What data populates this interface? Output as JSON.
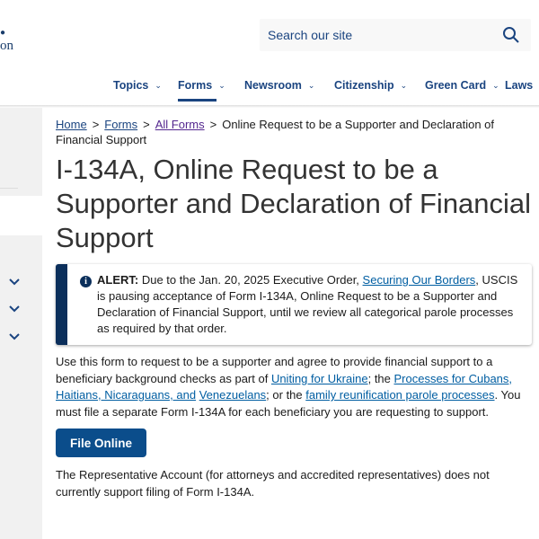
{
  "header": {
    "logo_fragment": "on",
    "search_placeholder": "Search our site",
    "nav": [
      {
        "label": "Topics",
        "active": false
      },
      {
        "label": "Forms",
        "active": true
      },
      {
        "label": "Newsroom",
        "active": false
      },
      {
        "label": "Citizenship",
        "active": false
      },
      {
        "label": "Green Card",
        "active": false
      },
      {
        "label": "Laws",
        "active": false
      }
    ]
  },
  "breadcrumb": {
    "items": [
      "Home",
      "Forms",
      "All Forms"
    ],
    "current": "Online Request to be a Supporter and Declaration of Financial Support"
  },
  "title": {
    "line1": "I-134A, Online Request to be a Supporter and",
    "line2": "Declaration of Financial Support"
  },
  "alert": {
    "label": "ALERT:",
    "t1": " Due to the Jan. 20, 2025 Executive Order, ",
    "link": "Securing Our Borders",
    "t2": ", USCIS is pausing acceptance",
    "line2": "of Form I-134A, Online Request to be a Supporter and Declaration of Financial Support, until we",
    "line3": "review all categorical parole processes as required by that order."
  },
  "intro": {
    "l1": "Use this form to request to be a supporter and agree to provide financial support to a beneficiary",
    "l2a": "background checks as part of ",
    "link1": "Uniting for Ukraine",
    "l2b": "; the ",
    "link2": "Processes for Cubans, Haitians, Nicaraguans, and",
    "link3": "Venezuelans",
    "l3a": "; or the ",
    "link4": "family reunification parole processes",
    "l3b": ". You must file a separate Form I-134A for each",
    "l4": "beneficiary you are requesting to support."
  },
  "file_online_label": "File Online",
  "representative_note": {
    "l1": "The Representative Account (for attorneys and accredited representatives) does not currently support",
    "l2": "filing of Form I-134A."
  },
  "colors": {
    "primary": "#1a4480",
    "alert_bar": "#0b2f5b",
    "button": "#0b4d8b",
    "link": "#005ea2"
  }
}
